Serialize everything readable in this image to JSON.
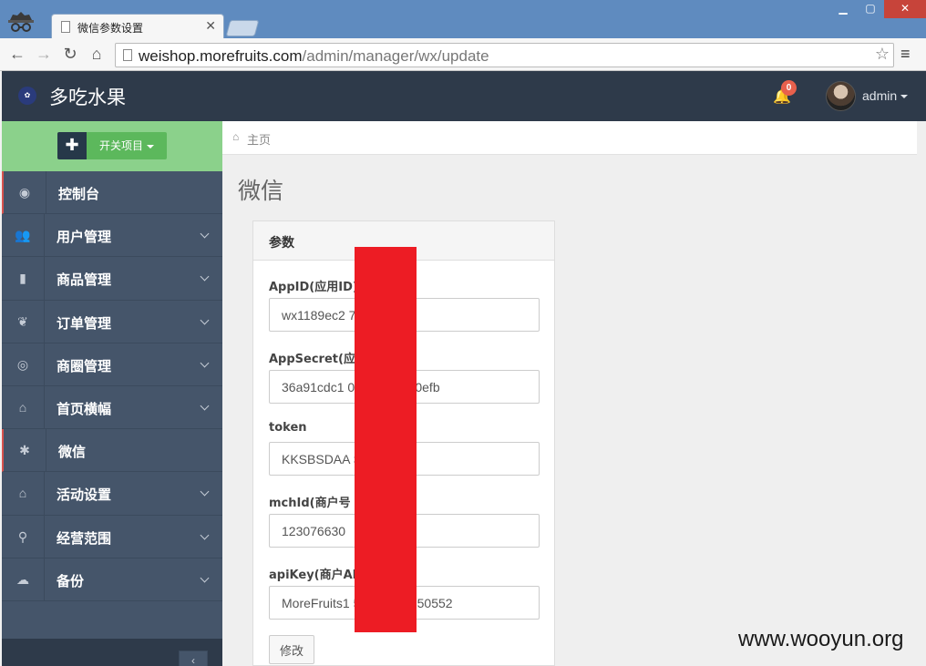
{
  "browser": {
    "tab_title": "微信参数设置",
    "url_host": "weishop.morefruits.com",
    "url_path": "/admin/manager/wx/update"
  },
  "header": {
    "brand": "多吃水果",
    "notification_count": "0",
    "user": "admin"
  },
  "sidebar": {
    "plus_label": "✚",
    "toggle_label": "开关项目",
    "items": [
      {
        "label": "控制台",
        "icon": "dashboard-icon",
        "glyph": "◉",
        "has_submenu": false
      },
      {
        "label": "用户管理",
        "icon": "users-icon",
        "glyph": "👥",
        "has_submenu": true
      },
      {
        "label": "商品管理",
        "icon": "briefcase-icon",
        "glyph": "▮",
        "has_submenu": true
      },
      {
        "label": "订单管理",
        "icon": "leaf-icon",
        "glyph": "❦",
        "has_submenu": true
      },
      {
        "label": "商圈管理",
        "icon": "target-icon",
        "glyph": "◎",
        "has_submenu": true
      },
      {
        "label": "首页横幅",
        "icon": "home-icon",
        "glyph": "⌂",
        "has_submenu": true
      },
      {
        "label": "微信",
        "icon": "asterisk-icon",
        "glyph": "✱",
        "has_submenu": false
      },
      {
        "label": "活动设置",
        "icon": "home-icon",
        "glyph": "⌂",
        "has_submenu": true
      },
      {
        "label": "经营范围",
        "icon": "map-marker-icon",
        "glyph": "⚲",
        "has_submenu": true
      },
      {
        "label": "备份",
        "icon": "cloud-download-icon",
        "glyph": "☁",
        "has_submenu": true
      }
    ],
    "collapse_glyph": "‹"
  },
  "breadcrumb": {
    "home": "主页"
  },
  "page": {
    "title": "微信"
  },
  "panel": {
    "title": "参数",
    "fields": [
      {
        "label": "AppID(应用ID)",
        "value": "wx1189ec2 7e"
      },
      {
        "label": "AppSecret(应",
        "value": "36a91cdc1 0fd73958980efb"
      },
      {
        "label": "token",
        "value": "KKSBSDAA SDAB"
      },
      {
        "label": "mchId(商户号",
        "value": "123076630"
      },
      {
        "label": "apiKey(商户AI",
        "value": "MoreFruits1 55218515850552"
      }
    ],
    "save_label": "修改"
  },
  "watermark": "www.wooyun.org",
  "colors": {
    "titlebar": "#5f8bbf",
    "appbar": "#2e3a4a",
    "sidebar": "#45556a",
    "sidebar_top": "#8bd18b",
    "toggle_green": "#5cb85c",
    "badge": "#e8604c",
    "redaction": "#ed1c24"
  }
}
